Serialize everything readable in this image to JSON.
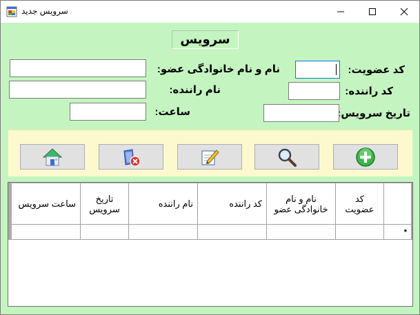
{
  "window": {
    "title": "سرویس جدید",
    "accent_color": "#c4f5c0"
  },
  "form": {
    "heading": "سرویس",
    "member_code_label": "کد عضویت:",
    "member_code_value": "",
    "member_name_label": "نام و نام خانوادگی عضو:",
    "member_name_value": "",
    "driver_code_label": "کد راننده:",
    "driver_code_value": "",
    "driver_name_label": "نام راننده:",
    "driver_name_value": "",
    "service_date_label": "تاریخ سرویس:",
    "service_date_value": "",
    "time_label": "ساعت:",
    "time_value": ""
  },
  "toolbar": {
    "background": "#fdf9cf",
    "buttons": [
      {
        "icon": "add-icon"
      },
      {
        "icon": "search-icon"
      },
      {
        "icon": "edit-icon"
      },
      {
        "icon": "delete-icon"
      },
      {
        "icon": "home-icon"
      }
    ]
  },
  "grid": {
    "columns": [
      "کد عضویت",
      "نام و نام خانوادگی عضو",
      "کد راننده",
      "نام راننده",
      "تاریخ سرویس",
      "ساعت سرویس"
    ],
    "new_row_marker": "*"
  }
}
